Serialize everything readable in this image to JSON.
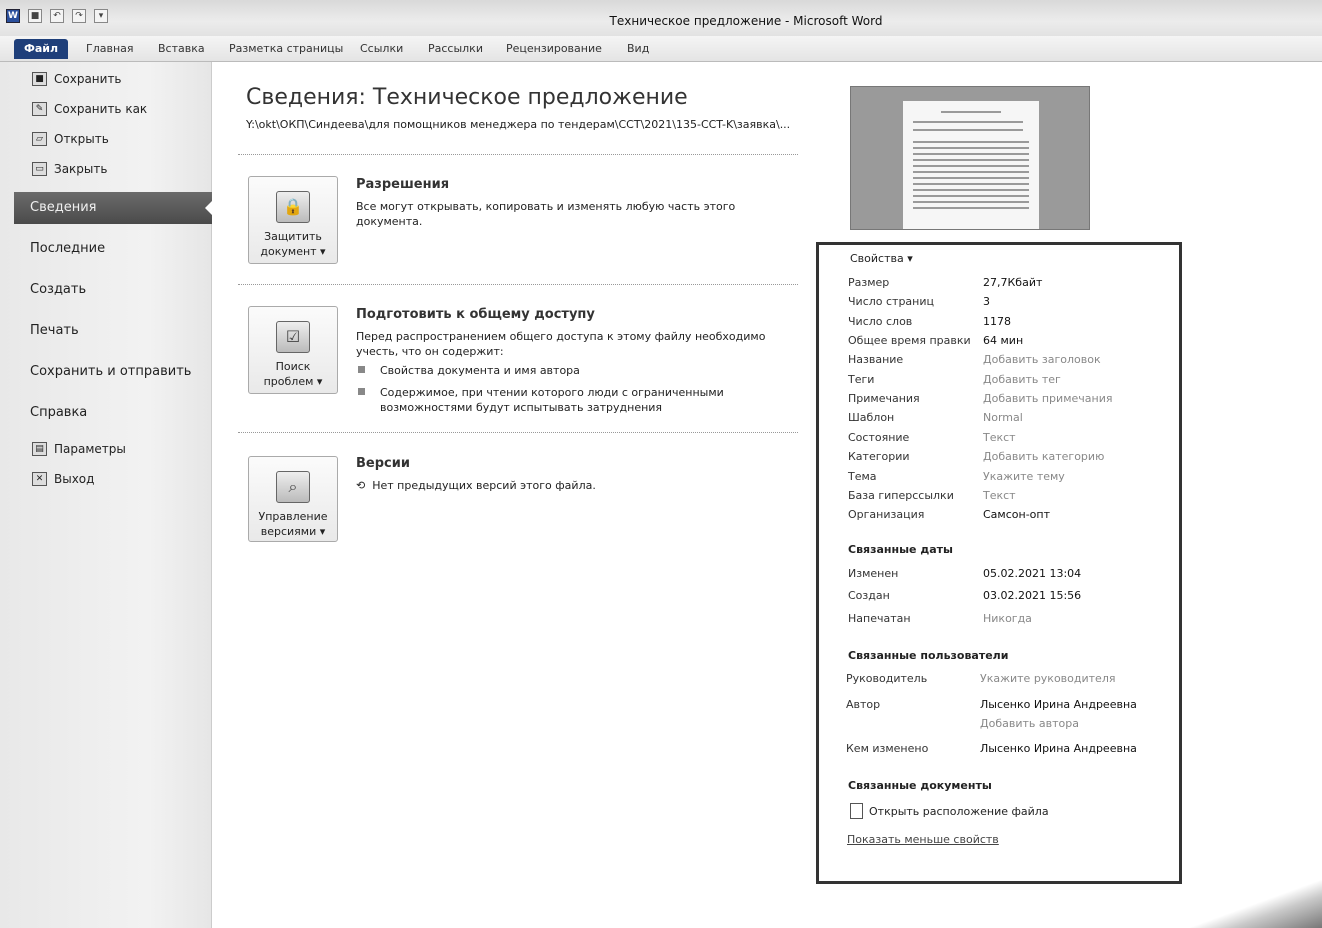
{
  "titlebar": {
    "title": "Техническое предложение - Microsoft Word",
    "app_icon": "W"
  },
  "ribbon": {
    "file_tab": "Файл",
    "tabs": [
      "Главная",
      "Вставка",
      "Разметка страницы",
      "Ссылки",
      "Рассылки",
      "Рецензирование",
      "Вид"
    ]
  },
  "nav": {
    "save": "Сохранить",
    "save_as": "Сохранить как",
    "open": "Открыть",
    "close": "Закрыть",
    "info": "Сведения",
    "recent": "Последние",
    "new": "Создать",
    "print": "Печать",
    "save_send": "Сохранить и отправить",
    "help": "Справка",
    "options": "Параметры",
    "exit": "Выход"
  },
  "info": {
    "title": "Сведения: Техническое предложение",
    "path": "Y:\\okt\\ОКП\\Синдеева\\для помощников менеджера по тендерам\\CCT\\2021\\135-CCT-K\\заявка\\..."
  },
  "permissions": {
    "btn_line1": "Защитить",
    "btn_line2": "документ ▾",
    "title": "Разрешения",
    "text": "Все могут открывать, копировать и изменять любую часть этого документа."
  },
  "prepare": {
    "btn_line1": "Поиск",
    "btn_line2": "проблем ▾",
    "title": "Подготовить к общему доступу",
    "text": "Перед распространением общего доступа к этому файлу необходимо учесть, что он содержит:",
    "bullets": [
      "Свойства документа и имя автора",
      "Содержимое, при чтении которого люди с ограниченными возможностями будут испытывать затруднения"
    ]
  },
  "versions": {
    "btn_line1": "Управление",
    "btn_line2": "версиями ▾",
    "title": "Версии",
    "text": "Нет предыдущих версий этого файла."
  },
  "properties": {
    "header": "Свойства ▾",
    "size_label": "Размер",
    "size": "27,7Кбайт",
    "pages_label": "Число страниц",
    "pages": "3",
    "words_label": "Число слов",
    "words": "1178",
    "edit_time_label": "Общее время правки",
    "edit_time": "64 мин",
    "name_label": "Название",
    "name": "Добавить заголовок",
    "tags_label": "Теги",
    "tags": "Добавить тег",
    "comments_label": "Примечания",
    "comments": "Добавить примечания",
    "template_label": "Шаблон",
    "template": "Normal",
    "status_label": "Состояние",
    "status": "Текст",
    "categories_label": "Категории",
    "categories": "Добавить категорию",
    "subject_label": "Тема",
    "subject": "Укажите тему",
    "hyperlink_label": "База гиперссылки",
    "hyperlink": "Текст",
    "company_label": "Организация",
    "company": "Самсон-опт"
  },
  "dates": {
    "title": "Связанные даты",
    "modified_label": "Изменен",
    "modified": "05.02.2021 13:04",
    "created_label": "Создан",
    "created": "03.02.2021 15:56",
    "printed_label": "Напечатан",
    "printed": "Никогда"
  },
  "people": {
    "title": "Связанные пользователи",
    "manager_label": "Руководитель",
    "manager": "Укажите руководителя",
    "author_label": "Автор",
    "author": "Лысенко Ирина Андреевна",
    "add_author": "Добавить автора",
    "modified_by_label": "Кем изменено",
    "modified_by": "Лысенко Ирина Андреевна"
  },
  "documents": {
    "title": "Связанные документы",
    "open_location": "Открыть расположение файла",
    "show_less": "Показать меньше свойств"
  }
}
